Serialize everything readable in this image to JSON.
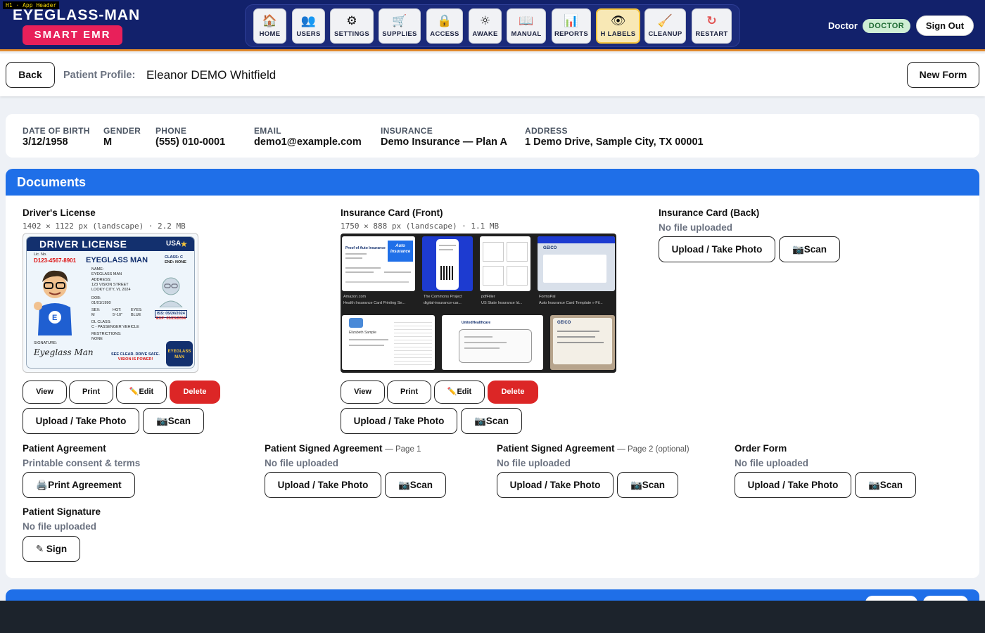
{
  "header": {
    "dev_tag": "H1 · App Header",
    "brand_title": "EYEGLASS-MAN",
    "brand_badge": "SMART EMR",
    "nav": [
      {
        "label": "HOME",
        "icon": "home-icon",
        "glyph": "🏠"
      },
      {
        "label": "USERS",
        "icon": "users-icon",
        "glyph": "👥"
      },
      {
        "label": "SETTINGS",
        "icon": "gear-icon",
        "glyph": "⚙"
      },
      {
        "label": "SUPPLIES",
        "icon": "cart-icon",
        "glyph": "🛒"
      },
      {
        "label": "ACCESS",
        "icon": "lock-icon",
        "glyph": "🔒"
      },
      {
        "label": "AWAKE",
        "icon": "sun-icon",
        "glyph": "☼"
      },
      {
        "label": "MANUAL",
        "icon": "book-icon",
        "glyph": "📖"
      },
      {
        "label": "REPORTS",
        "icon": "chart-icon",
        "glyph": "📊"
      },
      {
        "label": "H LABELS",
        "icon": "eye-icon",
        "glyph": "👁"
      },
      {
        "label": "CLEANUP",
        "icon": "broom-icon",
        "glyph": "🧹"
      },
      {
        "label": "RESTART",
        "icon": "restart-icon",
        "glyph": "↻"
      }
    ],
    "active_nav": "H LABELS",
    "doctor_name": "Doctor",
    "role_badge": "DOCTOR",
    "sign_out": "Sign Out"
  },
  "profile_bar": {
    "back": "Back",
    "label": "Patient Profile:",
    "patient_name": "Eleanor DEMO Whitfield",
    "new_form": "New Form"
  },
  "demographics": [
    {
      "key": "DATE OF BIRTH",
      "value": "3/12/1958"
    },
    {
      "key": "GENDER",
      "value": "M"
    },
    {
      "key": "PHONE",
      "value": "(555) 010-0001"
    },
    {
      "key": "EMAIL",
      "value": "demo1@example.com"
    },
    {
      "key": "INSURANCE",
      "value": "Demo Insurance — Plan A"
    },
    {
      "key": "ADDRESS",
      "value": "1 Demo Drive, Sample City, TX 00001"
    }
  ],
  "documents": {
    "heading": "Documents",
    "drivers_license": {
      "title": "Driver's License",
      "meta": "1402 × 1122 px (landscape) · 2.2 MB",
      "card": {
        "header": "DRIVER LICENSE",
        "country": "USA",
        "lic_no_label": "Lic. No.",
        "lic_no": "D123-4567-8901",
        "class_label": "CLASS: C",
        "end_label": "END: NONE",
        "name_big": "EYEGLASS MAN",
        "name_label": "NAME:",
        "name": "EYEGLASS MAN",
        "address_label": "ADDRESS:",
        "address1": "123 VISION STREET",
        "address2": "LOOKY CITY, VL 2024",
        "dob_label": "DOB:",
        "dob": "01/01/1990",
        "sex_label": "SEX:",
        "sex": "M",
        "hgt_label": "HGT:",
        "hgt": "5'-10\"",
        "eyes_label": "EYES:",
        "eyes": "BLUE",
        "iss": "ISS: 05/20/2024",
        "exp": "EXP: 05/20/2034",
        "dl_class_label": "DL CLASS:",
        "dl_class": "C - PASSENGER VEHICLE",
        "restrictions_label": "RESTRICTIONS:",
        "restrictions": "NONE",
        "signature_label": "SIGNATURE:",
        "signature": "Eyeglass Man",
        "slogan1": "SEE CLEAR. DRIVE SAFE.",
        "slogan2": "VISION IS POWER!",
        "logo_text": "EYEGLASS MAN"
      },
      "actions": [
        "View",
        "Print",
        "✏️Edit",
        "Delete"
      ],
      "upload": "Upload / Take Photo",
      "scan": "📷Scan"
    },
    "insurance_front": {
      "title": "Insurance Card (Front)",
      "meta": "1750 × 888 px (landscape) · 1.1 MB",
      "captions": [
        {
          "source": "Amazon.com",
          "title": "Health Insurance Card Printing Se..."
        },
        {
          "source": "The Commons Project",
          "title": "digital-insurance-car..."
        },
        {
          "source": "pdfFiller",
          "title": "US State Insurance Id..."
        },
        {
          "source": "FormsPal",
          "title": "Auto Insurance Card Template » Fil..."
        }
      ],
      "tile_text": {
        "proof": "Proof of Auto Insurance",
        "auto": "Auto Insurance",
        "geico": "GEICO",
        "name": "Elizabeth Sample",
        "uhc": "UnitedHealthcare"
      },
      "actions": [
        "View",
        "Print",
        "✏️Edit",
        "Delete"
      ],
      "upload": "Upload / Take Photo",
      "scan": "📷Scan"
    },
    "insurance_back": {
      "title": "Insurance Card (Back)",
      "status": "No file uploaded",
      "upload": "Upload / Take Photo",
      "scan": "📷Scan"
    },
    "patient_agreement": {
      "title": "Patient Agreement",
      "status": "Printable consent & terms",
      "print": "🖨️Print Agreement"
    },
    "signed_page1": {
      "title": "Patient Signed Agreement",
      "sub": "— Page 1",
      "status": "No file uploaded",
      "upload": "Upload / Take Photo",
      "scan": "📷Scan"
    },
    "signed_page2": {
      "title": "Patient Signed Agreement",
      "sub": "— Page 2 (optional)",
      "status": "No file uploaded",
      "upload": "Upload / Take Photo",
      "scan": "📷Scan"
    },
    "order_form": {
      "title": "Order Form",
      "status": "No file uploaded",
      "upload": "Upload / Take Photo",
      "scan": "📷Scan"
    },
    "patient_signature": {
      "title": "Patient Signature",
      "status": "No file uploaded",
      "sign": "✎ Sign"
    }
  },
  "colors": {
    "header_bg": "#12216b",
    "accent_orange": "#e0892c",
    "brand_pink": "#e8205a",
    "section_blue": "#1f6fe8",
    "danger_red": "#dc2626",
    "role_green": "#cfeed4"
  }
}
